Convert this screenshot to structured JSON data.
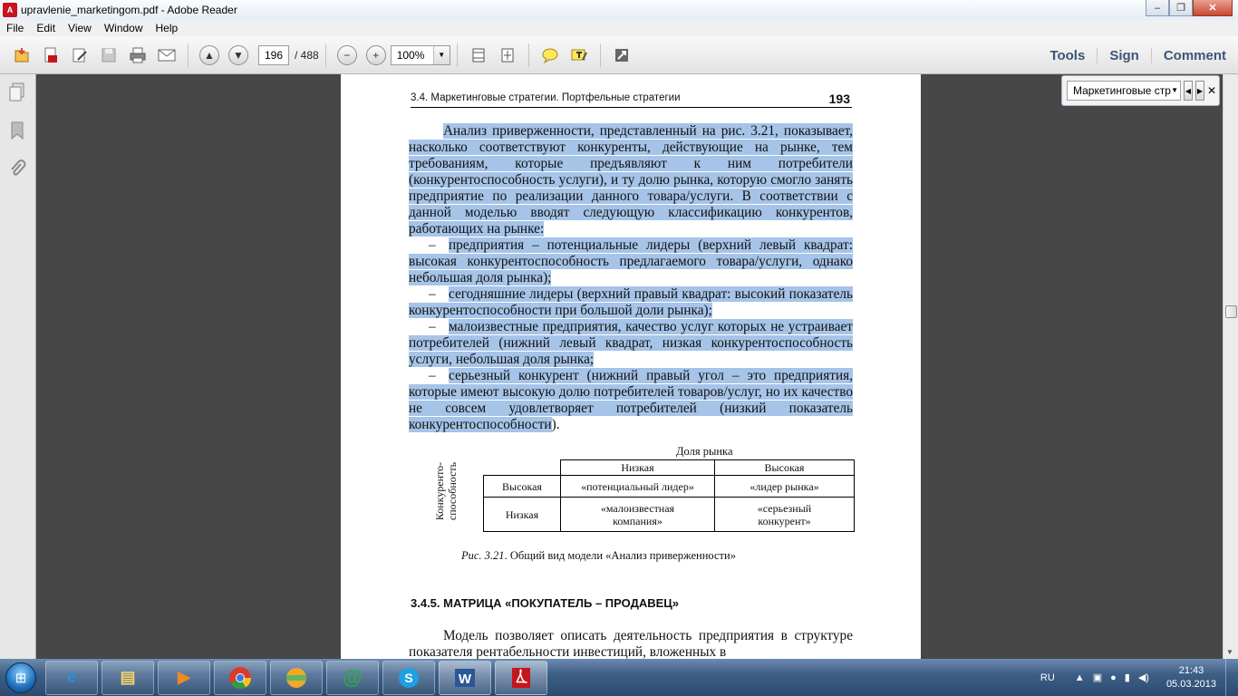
{
  "window": {
    "title": "upravlenie_marketingom.pdf - Adobe Reader",
    "minimize": "–",
    "restore": "❐",
    "close": "✕"
  },
  "menu": [
    "File",
    "Edit",
    "View",
    "Window",
    "Help"
  ],
  "toolbar": {
    "page_current": "196",
    "page_total": "/ 488",
    "zoom": "100%",
    "right": [
      "Tools",
      "Sign",
      "Comment"
    ]
  },
  "find": {
    "value": "Маркетинговые стр"
  },
  "document": {
    "running_head": "3.4. Маркетинговые стратегии. Портфельные стратегии",
    "page_number": "193",
    "paragraph1": "Анализ приверженности, представленный на рис. 3.21, показывает, насколько соответствуют конкуренты, действующие на рынке, тем требованиям, которые предъявляют к ним потребители (конкурентоспособность услуги), и ту долю рынка, которую смогло занять предприятие по реализации данного товара/услуги. В соответствии с данной моделью вводят следующую классификацию конкурентов, работающих на рынке:",
    "list_dash": "–",
    "list": [
      "предприятия – потенциальные лидеры (верхний левый квадрат: высокая конкурентоспособность предлагаемого товара/услуги, однако небольшая доля рынка);",
      "сегодняшние лидеры (верхний правый квадрат: высокий показатель конкурентоспособности при большой доли рынка);",
      "малоизвестные предприятия, качество услуг которых не устраивает потребителей (нижний левый квадрат, низкая конкурентоспособность услуги, небольшая доля рынка;",
      "серьезный конкурент (нижний правый угол – это предприятия, которые имеют высокую долю потребителей товаров/услуг, но их качество не совсем удовлетворяет потребителей (низкий показатель конкурентоспособности"
    ],
    "list_tail": ").",
    "figure": {
      "top_label": "Доля рынка",
      "side_label": "Конкуренто-способность",
      "col_low": "Низкая",
      "col_high": "Высокая",
      "row_high": "Высокая",
      "row_low": "Низкая",
      "cell_hl": "«потенциальный лидер»",
      "cell_hh": "«лидер рынка»",
      "cell_ll": "«малоизвестная компания»",
      "cell_lh": "«серьезный конкурент»",
      "caption_prefix": "Рис. 3.21",
      "caption_text": ". Общий вид модели «Анализ приверженности»"
    },
    "section_heading": "3.4.5. МАТРИЦА «ПОКУПАТЕЛЬ – ПРОДАВЕЦ»",
    "tail_paragraph": "Модель позволяет описать деятельность предприятия в структуре показателя рентабельности инвестиций, вложенных в"
  },
  "taskbar": {
    "apps": [
      "Internet Explorer",
      "Explorer",
      "Media",
      "Chrome",
      "Picasa",
      "Mail.Ru Agent",
      "Skype",
      "Word",
      "Adobe Reader"
    ],
    "lang": "RU",
    "time": "21:43",
    "date": "05.03.2013"
  }
}
